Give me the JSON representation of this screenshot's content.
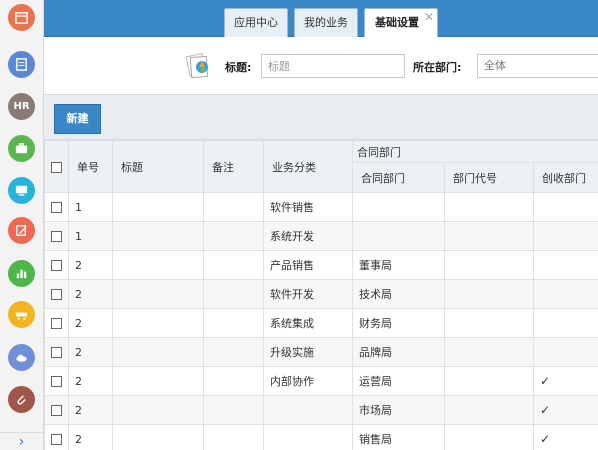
{
  "tabs": [
    {
      "label": "应用中心"
    },
    {
      "label": "我的业务"
    },
    {
      "label": "基础设置",
      "close": "✕"
    }
  ],
  "search": {
    "title_label": "标题:",
    "title_placeholder": "标题",
    "dept_label": "所在部门:",
    "dept_value": "全体"
  },
  "toolbar": {
    "new_label": "新建"
  },
  "sidebar": {
    "icons": [
      {
        "name": "calendar-icon",
        "color": "#e8754e"
      },
      {
        "name": "notes-icon",
        "color": "#5b87d4"
      },
      {
        "name": "hr-icon",
        "color": "#8a7a75",
        "text": "HR"
      },
      {
        "name": "briefcase-icon",
        "color": "#5bb651"
      },
      {
        "name": "monitor-icon",
        "color": "#28b4d8"
      },
      {
        "name": "edit-icon",
        "color": "#ef6a55"
      },
      {
        "name": "bar-chart-icon",
        "color": "#4cb84a"
      },
      {
        "name": "cart-icon",
        "color": "#f2b51f"
      },
      {
        "name": "cloud-icon",
        "color": "#6f8fd9"
      },
      {
        "name": "attachment-icon",
        "color": "#a0574a"
      }
    ],
    "expand": "›"
  },
  "table": {
    "group_header": "合同部门",
    "headers": {
      "id": "单号",
      "title": "标题",
      "remark": "备注",
      "category": "业务分类",
      "dept": "合同部门",
      "code": "部门代号",
      "income": "创收部门"
    },
    "rows": [
      {
        "id": "1",
        "title": "",
        "remark": "",
        "category": "软件销售",
        "dept": "",
        "code": "",
        "income": ""
      },
      {
        "id": "1",
        "title": "",
        "remark": "",
        "category": "系统开发",
        "dept": "",
        "code": "",
        "income": ""
      },
      {
        "id": "2",
        "title": "",
        "remark": "",
        "category": "产品销售",
        "dept": "董事局",
        "code": "",
        "income": ""
      },
      {
        "id": "2",
        "title": "",
        "remark": "",
        "category": "软件开发",
        "dept": "技术局",
        "code": "",
        "income": ""
      },
      {
        "id": "2",
        "title": "",
        "remark": "",
        "category": "系统集成",
        "dept": "财务局",
        "code": "",
        "income": ""
      },
      {
        "id": "2",
        "title": "",
        "remark": "",
        "category": "升级实施",
        "dept": "品牌局",
        "code": "",
        "income": ""
      },
      {
        "id": "2",
        "title": "",
        "remark": "",
        "category": "内部协作",
        "dept": "运营局",
        "code": "",
        "income": "✓"
      },
      {
        "id": "2",
        "title": "",
        "remark": "",
        "category": "",
        "dept": "市场局",
        "code": "",
        "income": "✓"
      },
      {
        "id": "2",
        "title": "",
        "remark": "",
        "category": "",
        "dept": "销售局",
        "code": "",
        "income": "✓"
      }
    ]
  }
}
